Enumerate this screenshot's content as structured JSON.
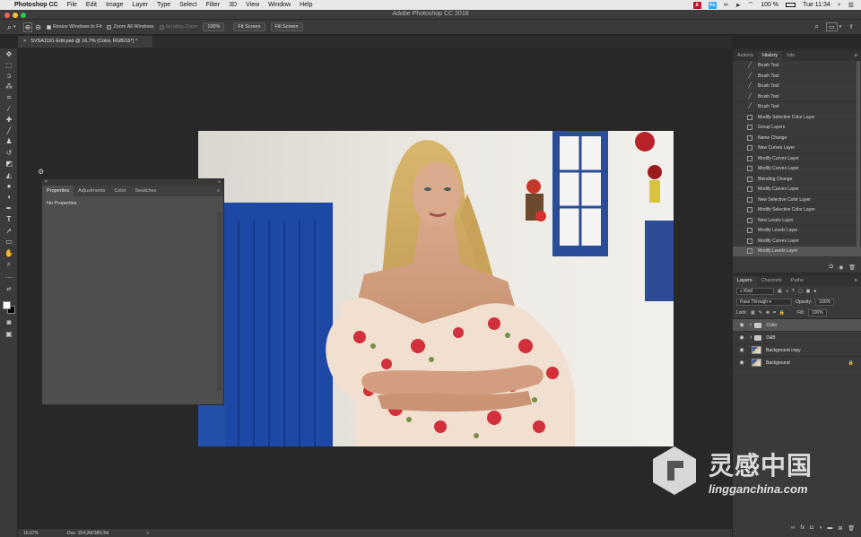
{
  "menubar": {
    "apple": "",
    "items": [
      "Photoshop CC",
      "File",
      "Edit",
      "Image",
      "Layer",
      "Type",
      "Select",
      "Filter",
      "3D",
      "View",
      "Window",
      "Help"
    ],
    "battery": "100 %",
    "clock": "Tue 11:34"
  },
  "window": {
    "title": "Adobe Photoshop CC 2018"
  },
  "options": {
    "resize_windows": "Resize Windows to Fit",
    "zoom_all": "Zoom All Windows",
    "scrubby": "Scrubby Zoom",
    "zoom_value": "100%",
    "fit_screen": "Fit Screen",
    "fill_screen": "Fill Screen"
  },
  "document": {
    "tab_title": "SVSA1191-Edit.psd @ 16,7% (Color, RGB/16*) *",
    "close": "×"
  },
  "status": {
    "zoom": "16,67%",
    "doc": "Doc: 154,2M/389,0M",
    "arrow": ">"
  },
  "properties_panel": {
    "tabs": [
      "Properties",
      "Adjustments",
      "Color",
      "Swatches"
    ],
    "active_tab": 0,
    "message": "No Properties"
  },
  "history_panel": {
    "tabs": [
      "Actions",
      "History",
      "Info"
    ],
    "active_tab": 1,
    "items": [
      {
        "label": "Brush Tool",
        "icon": "brush"
      },
      {
        "label": "Brush Tool",
        "icon": "brush"
      },
      {
        "label": "Brush Tool",
        "icon": "brush"
      },
      {
        "label": "Brush Tool",
        "icon": "brush"
      },
      {
        "label": "Brush Tool",
        "icon": "brush"
      },
      {
        "label": "Modify Selective Color Layer",
        "icon": "doc"
      },
      {
        "label": "Group Layers",
        "icon": "doc"
      },
      {
        "label": "Name Change",
        "icon": "doc"
      },
      {
        "label": "New Curves Layer",
        "icon": "doc"
      },
      {
        "label": "Modify Curves Layer",
        "icon": "doc"
      },
      {
        "label": "Modify Curves Layer",
        "icon": "doc"
      },
      {
        "label": "Blending Change",
        "icon": "doc"
      },
      {
        "label": "Modify Curves Layer",
        "icon": "doc"
      },
      {
        "label": "New Selective Color Layer",
        "icon": "doc"
      },
      {
        "label": "Modify Selective Color Layer",
        "icon": "doc"
      },
      {
        "label": "New Levels Layer",
        "icon": "doc"
      },
      {
        "label": "Modify Levels Layer",
        "icon": "doc"
      },
      {
        "label": "Modify Curves Layer",
        "icon": "doc"
      },
      {
        "label": "Modify Levels Layer",
        "icon": "doc"
      }
    ],
    "selected_index": 18
  },
  "layers_panel": {
    "tabs": [
      "Layers",
      "Channels",
      "Paths"
    ],
    "active_tab": 0,
    "kind_label": "Kind",
    "blend_mode": "Pass Through",
    "opacity_label": "Opacity:",
    "opacity_value": "100%",
    "lock_label": "Lock:",
    "fill_label": "Fill:",
    "fill_value": "100%",
    "layers": [
      {
        "name": "Color",
        "type": "group"
      },
      {
        "name": "D&B",
        "type": "group"
      },
      {
        "name": "Background copy",
        "type": "image"
      },
      {
        "name": "Background",
        "type": "image",
        "locked": true
      }
    ],
    "selected_index": 0
  },
  "watermark": {
    "brand": "灵感中国",
    "site": "lingganchina.com"
  }
}
